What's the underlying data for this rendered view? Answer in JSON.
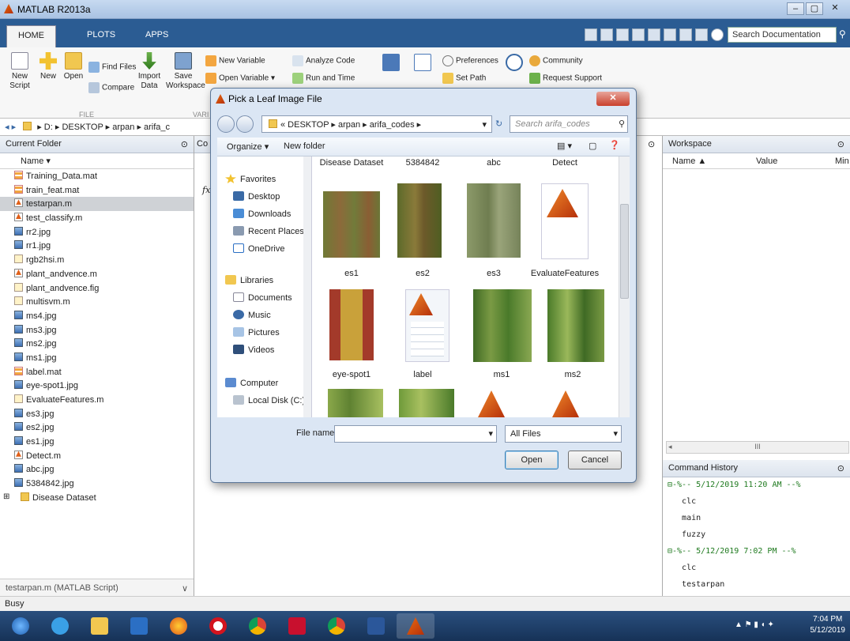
{
  "window": {
    "title": "MATLAB R2013a"
  },
  "tabs": [
    "HOME",
    "PLOTS",
    "APPS"
  ],
  "search": {
    "placeholder": "Search Documentation"
  },
  "ribbon": {
    "new_script": "New Script",
    "new": "New",
    "open": "Open",
    "find_files": "Find Files",
    "compare": "Compare",
    "import_data": "Import Data",
    "save_workspace": "Save Workspace",
    "new_variable": "New Variable",
    "open_variable": "Open Variable ▾",
    "analyze_code": "Analyze Code",
    "run_and_time": "Run and Time",
    "preferences": "Preferences",
    "set_path": "Set Path",
    "community": "Community",
    "request_support": "Request Support",
    "group_file": "FILE",
    "group_var": "VARI"
  },
  "address": {
    "path": "▸ D: ▸ DESKTOP ▸ arpan ▸ arifa_c"
  },
  "current_folder": {
    "title": "Current Folder",
    "col_name": "Name ▾",
    "files": [
      {
        "name": "Training_Data.mat",
        "kind": "mat"
      },
      {
        "name": "train_feat.mat",
        "kind": "mat"
      },
      {
        "name": "testarpan.m",
        "kind": "m"
      },
      {
        "name": "test_classify.m",
        "kind": "m"
      },
      {
        "name": "rr2.jpg",
        "kind": "jpg"
      },
      {
        "name": "rr1.jpg",
        "kind": "jpg"
      },
      {
        "name": "rgb2hsi.m",
        "kind": "fig"
      },
      {
        "name": "plant_andvence.m",
        "kind": "m"
      },
      {
        "name": "plant_andvence.fig",
        "kind": "fig"
      },
      {
        "name": "multisvm.m",
        "kind": "fig"
      },
      {
        "name": "ms4.jpg",
        "kind": "jpg"
      },
      {
        "name": "ms3.jpg",
        "kind": "jpg"
      },
      {
        "name": "ms2.jpg",
        "kind": "jpg"
      },
      {
        "name": "ms1.jpg",
        "kind": "jpg"
      },
      {
        "name": "label.mat",
        "kind": "mat"
      },
      {
        "name": "eye-spot1.jpg",
        "kind": "jpg"
      },
      {
        "name": "EvaluateFeatures.m",
        "kind": "fig"
      },
      {
        "name": "es3.jpg",
        "kind": "jpg"
      },
      {
        "name": "es2.jpg",
        "kind": "jpg"
      },
      {
        "name": "es1.jpg",
        "kind": "jpg"
      },
      {
        "name": "Detect.m",
        "kind": "m"
      },
      {
        "name": "abc.jpg",
        "kind": "jpg"
      },
      {
        "name": "5384842.jpg",
        "kind": "jpg"
      },
      {
        "name": "Disease Dataset",
        "kind": "dir"
      }
    ],
    "footer": "testarpan.m (MATLAB Script)"
  },
  "cmd": {
    "co": "Co",
    "fx": "fx"
  },
  "workspace": {
    "title": "Workspace",
    "col_name": "Name ▲",
    "col_value": "Value",
    "col_min": "Min",
    "scroll": "III"
  },
  "history": {
    "title": "Command History",
    "lines": [
      {
        "text": "⊟-%-- 5/12/2019 11:20 AM --%",
        "stamp": true
      },
      {
        "text": "   clc",
        "stamp": false
      },
      {
        "text": "   main",
        "stamp": false
      },
      {
        "text": "   fuzzy",
        "stamp": false
      },
      {
        "text": "⊟-%-- 5/12/2019 7:02 PM --%",
        "stamp": true
      },
      {
        "text": "   clc",
        "stamp": false
      },
      {
        "text": "   testarpan",
        "stamp": false
      }
    ]
  },
  "status": "Busy",
  "clock": {
    "time": "7:04 PM",
    "date": "5/12/2019"
  },
  "dialog": {
    "title": "Pick a Leaf Image File",
    "path": "« DESKTOP ▸ arpan ▸ arifa_codes ▸",
    "search_placeholder": "Search arifa_codes",
    "organize": "Organize ▾",
    "new_folder": "New folder",
    "nav": {
      "favorites": "Favorites",
      "desktop": "Desktop",
      "downloads": "Downloads",
      "recent": "Recent Places",
      "onedrive": "OneDrive",
      "libraries": "Libraries",
      "documents": "Documents",
      "music": "Music",
      "pictures": "Pictures",
      "videos": "Videos",
      "computer": "Computer",
      "local_disk": "Local Disk (C:)"
    },
    "top_labels": [
      "Disease Dataset",
      "5384842",
      "abc",
      "Detect"
    ],
    "row1_labels": [
      "es1",
      "es2",
      "es3",
      "EvaluateFeatures"
    ],
    "row2_labels": [
      "eye-spot1",
      "label",
      "ms1",
      "ms2"
    ],
    "file_name_label": "File name:",
    "filter": "All Files",
    "open": "Open",
    "cancel": "Cancel"
  }
}
